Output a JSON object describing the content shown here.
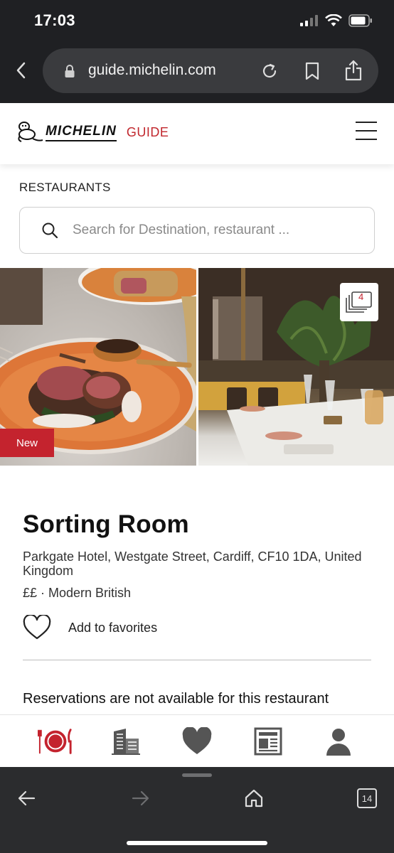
{
  "status_bar": {
    "time": "17:03"
  },
  "browser": {
    "url": "guide.michelin.com",
    "tab_count": "14"
  },
  "header": {
    "brand": "MICHELIN",
    "guide_label": "GUIDE"
  },
  "search": {
    "section_label": "RESTAURANTS",
    "placeholder": "Search for Destination, restaurant ..."
  },
  "gallery": {
    "badge": "New",
    "photo_count": "4"
  },
  "restaurant": {
    "name": "Sorting Room",
    "address": "Parkgate Hotel, Westgate Street, Cardiff, CF10 1DA, United Kingdom",
    "price_cuisine": "££ · Modern British",
    "favorite_label": "Add to favorites",
    "reservation_note": "Reservations are not available for this restaurant"
  },
  "tabbar": {
    "items": [
      "restaurants-icon",
      "hotels-icon",
      "favorites-icon",
      "magazine-icon",
      "profile-icon"
    ]
  },
  "colors": {
    "brand_red": "#c4232e",
    "browser_chrome": "#1f2023"
  }
}
